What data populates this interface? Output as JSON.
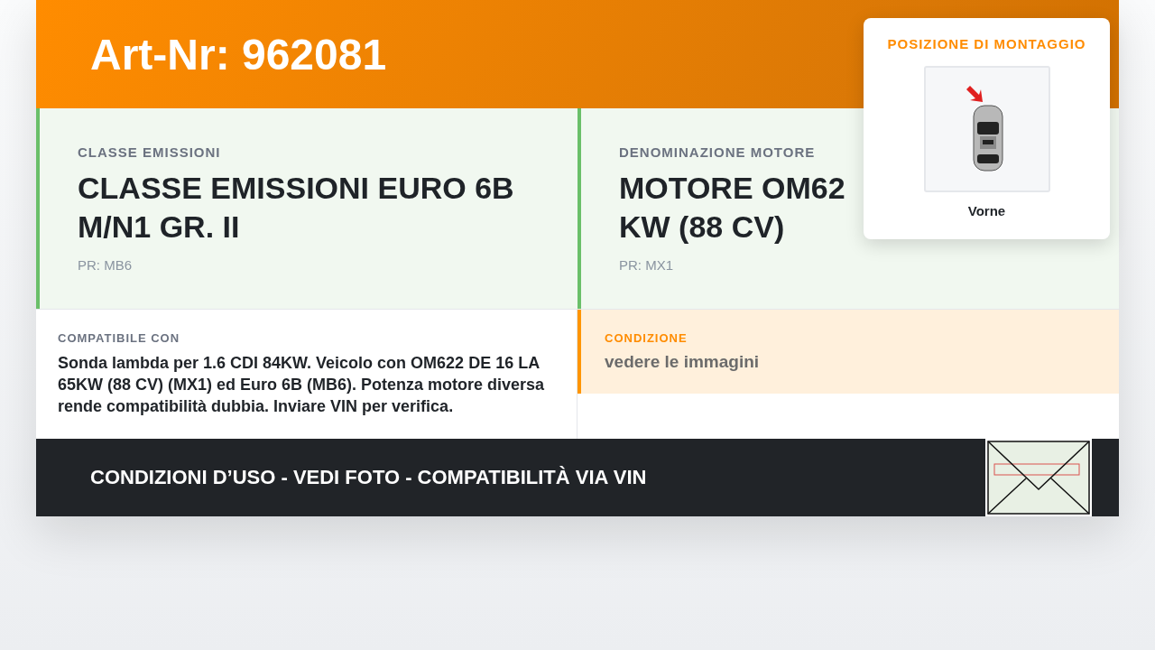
{
  "header": {
    "title": "Art-Nr: 962081"
  },
  "specs": [
    {
      "label": "CLASSE EMISSIONI",
      "value_lines": [
        "CLASSE EMISSIONI EURO 6B",
        "M/N1 GR. II"
      ],
      "code": "PR: MB6"
    },
    {
      "label": "DENOMINAZIONE MOTORE",
      "value_lines": [
        "MOTORE OM62",
        "KW (88 CV)"
      ],
      "code": "PR: MX1"
    }
  ],
  "compatibility": {
    "label": "COMPATIBILE CON",
    "text": "Sonda lambda per 1.6 CDI 84KW. Veicolo con OM622 DE 16 LA 65KW (88 CV) (MX1) ed Euro 6B (MB6). Potenza motore diversa rende compatibilità dubbia. Inviare VIN per verifica."
  },
  "condition": {
    "label": "CONDIZIONE",
    "value": "vedere le immagini"
  },
  "footer": {
    "text": "CONDIZIONI D’USO - VEDI FOTO - COMPATIBILITÀ VIA VIN"
  },
  "mounting": {
    "title": "POSIZIONE DI MONTAGGIO",
    "position": "Vorne"
  }
}
